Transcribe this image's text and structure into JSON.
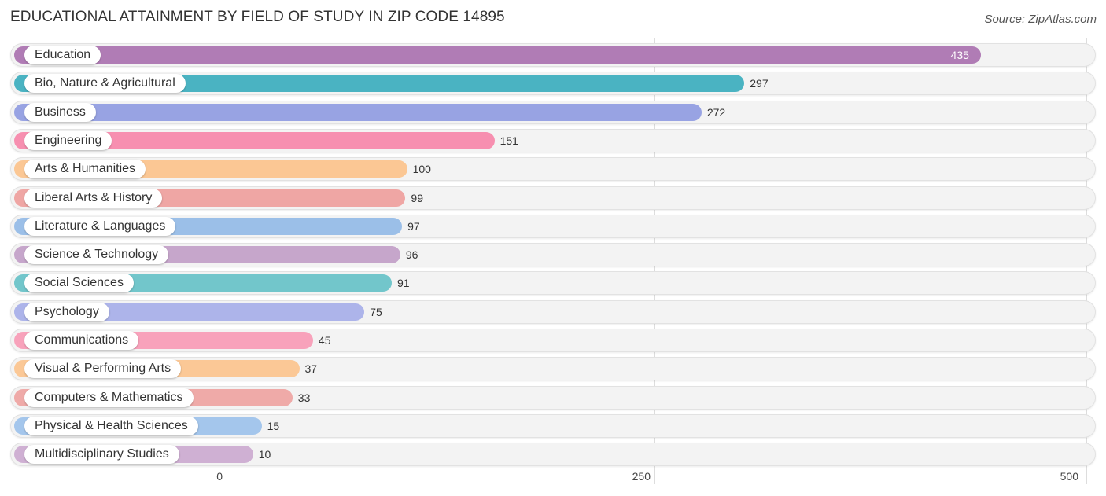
{
  "header": {
    "title": "EDUCATIONAL ATTAINMENT BY FIELD OF STUDY IN ZIP CODE 14895",
    "source": "Source: ZipAtlas.com"
  },
  "chart_data": {
    "type": "bar",
    "orientation": "horizontal",
    "title": "EDUCATIONAL ATTAINMENT BY FIELD OF STUDY IN ZIP CODE 14895",
    "xlabel": "",
    "ylabel": "",
    "xlim": [
      0,
      500
    ],
    "grid": true,
    "xticks": [
      0,
      250,
      500
    ],
    "xtick_labels": [
      "0",
      "250",
      "500"
    ],
    "categories": [
      "Education",
      "Bio, Nature & Agricultural",
      "Business",
      "Engineering",
      "Arts & Humanities",
      "Liberal Arts & History",
      "Literature & Languages",
      "Science & Technology",
      "Social Sciences",
      "Psychology",
      "Communications",
      "Visual & Performing Arts",
      "Computers & Mathematics",
      "Physical & Health Sciences",
      "Multidisciplinary Studies"
    ],
    "values": [
      435,
      297,
      272,
      151,
      100,
      99,
      97,
      96,
      91,
      75,
      45,
      37,
      33,
      15,
      10
    ],
    "colors": [
      "#b07cb5",
      "#4ab3c2",
      "#98a3e3",
      "#f78fb0",
      "#fbc794",
      "#efa6a4",
      "#9bbfe8",
      "#c6a6cb",
      "#72c6cb",
      "#adb4ea",
      "#f8a2bb",
      "#fbc896",
      "#efaaa8",
      "#a4c6ec",
      "#cfb0d3"
    ]
  }
}
